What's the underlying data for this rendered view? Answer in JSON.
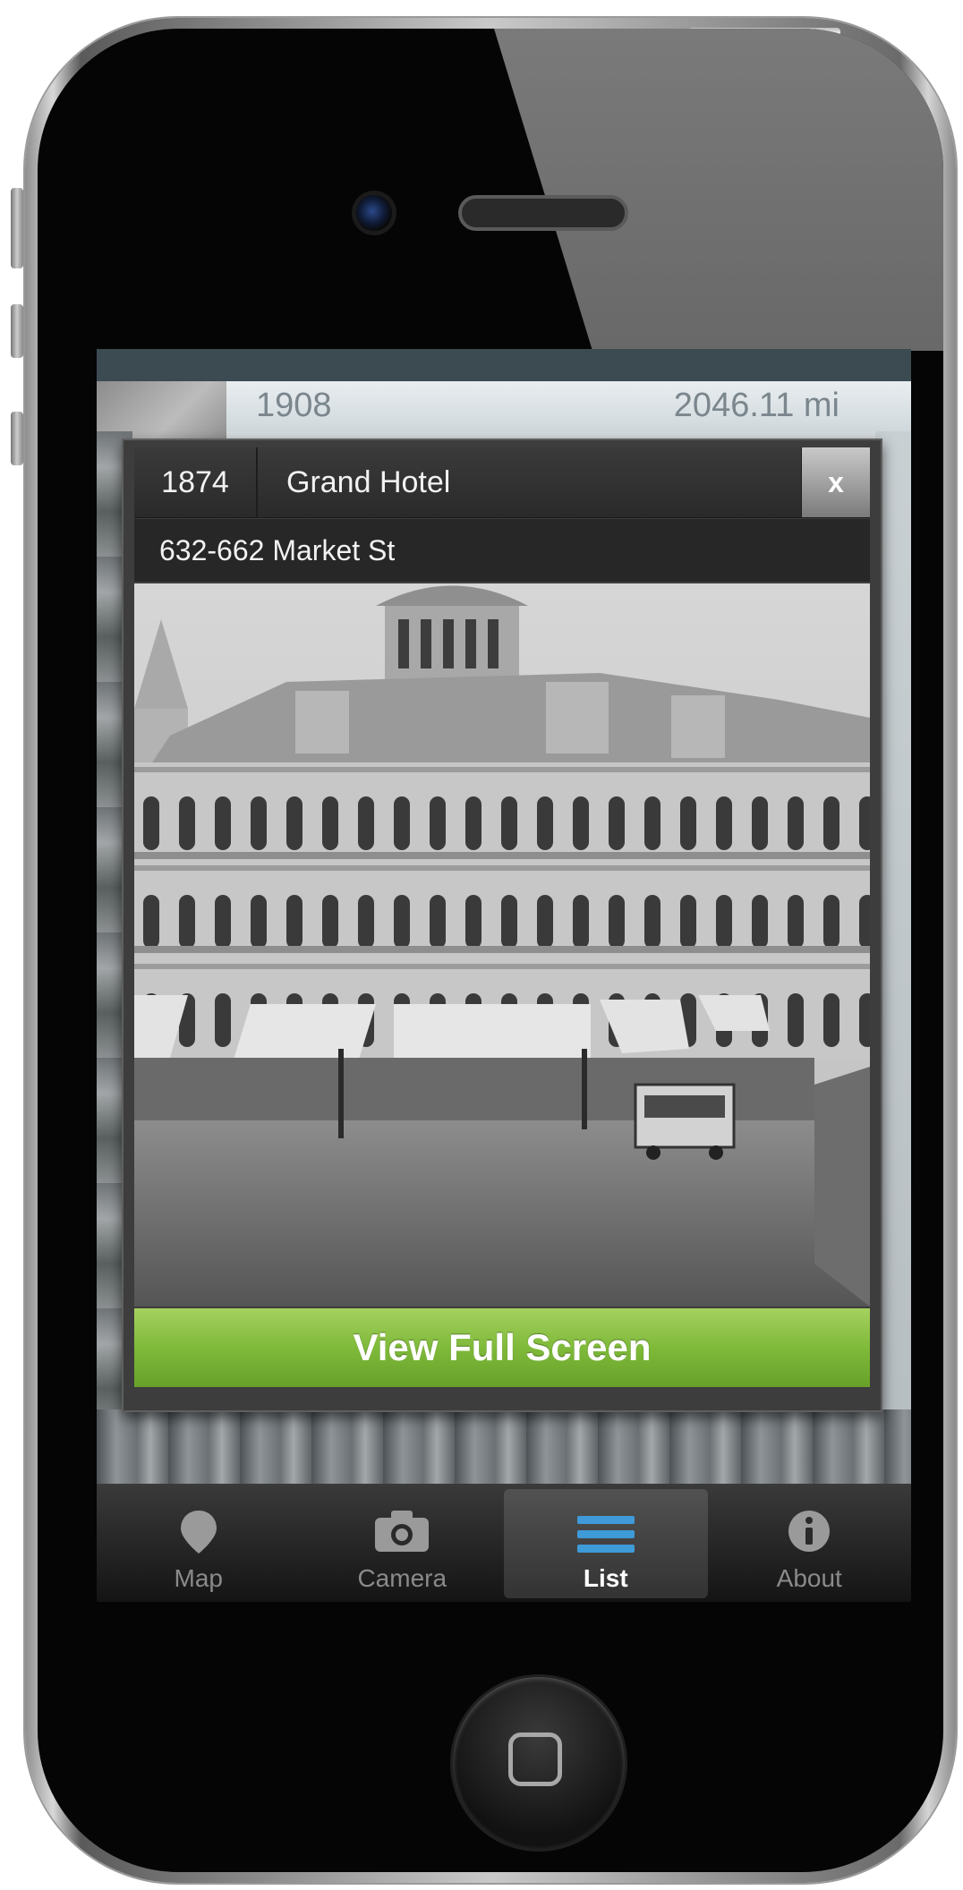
{
  "list_row": {
    "year": "1908",
    "distance": "2046.11 mi"
  },
  "card": {
    "year": "1874",
    "title": "Grand Hotel",
    "address": "632-662 Market St",
    "close_label": "x",
    "view_full_label": "View Full Screen",
    "view_full_color": "#7fba3a"
  },
  "tabs": [
    {
      "label": "Map",
      "icon": "map-pin-icon",
      "active": false
    },
    {
      "label": "Camera",
      "icon": "camera-icon",
      "active": false
    },
    {
      "label": "List",
      "icon": "list-icon",
      "active": true
    },
    {
      "label": "About",
      "icon": "info-icon",
      "active": false
    }
  ]
}
